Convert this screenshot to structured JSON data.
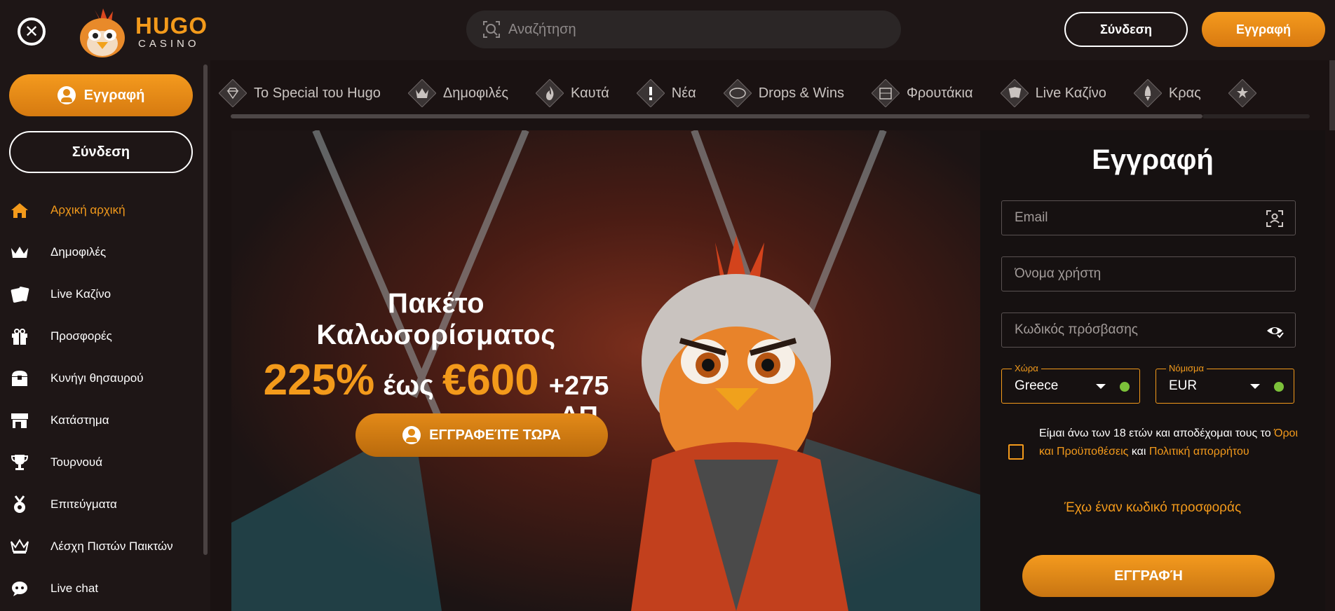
{
  "brand": {
    "name": "HUGO",
    "sub": "CASINO"
  },
  "header": {
    "search_placeholder": "Αναζήτηση",
    "login_label": "Σύνδεση",
    "register_label": "Εγγραφή"
  },
  "sidebar": {
    "register_label": "Εγγραφή",
    "login_label": "Σύνδεση",
    "items": [
      {
        "label": "Αρχική αρχική",
        "icon": "home-icon",
        "active": true
      },
      {
        "label": "Δημοφιλές",
        "icon": "crown-icon"
      },
      {
        "label": "Live Καζίνο",
        "icon": "cards-icon"
      },
      {
        "label": "Προσφορές",
        "icon": "gift-icon"
      },
      {
        "label": "Κυνήγι θησαυρού",
        "icon": "treasure-chest-icon"
      },
      {
        "label": "Κατάστημα",
        "icon": "store-icon"
      },
      {
        "label": "Τουρνουά",
        "icon": "trophy-icon"
      },
      {
        "label": "Επιτεύγματα",
        "icon": "medal-icon"
      },
      {
        "label": "Λέσχη Πιστών Παικτών",
        "icon": "vip-crown-icon"
      },
      {
        "label": "Live chat",
        "icon": "chat-icon"
      }
    ]
  },
  "categories": [
    {
      "label": "Το Special του Hugo",
      "icon": "diamond-icon"
    },
    {
      "label": "Δημοφιλές",
      "icon": "crown-icon"
    },
    {
      "label": "Καυτά",
      "icon": "flame-icon"
    },
    {
      "label": "Νέα",
      "icon": "alert-icon"
    },
    {
      "label": "Drops & Wins",
      "icon": "drops-wins-icon"
    },
    {
      "label": "Φρουτάκια",
      "icon": "slot-icon"
    },
    {
      "label": "Live Καζίνο",
      "icon": "cards-icon"
    },
    {
      "label": "Κρας",
      "icon": "rocket-icon"
    }
  ],
  "banner": {
    "line1": "Πακέτο Καλωσορίσματος",
    "percent": "225%",
    "upto": "έως",
    "amount": "€600",
    "freespins": "+275 ΔΠ",
    "cta": "ΕΓΓΡΑΦΕΊΤΕ ΤΩΡΑ"
  },
  "register": {
    "title": "Εγγραφή",
    "email_placeholder": "Email",
    "username_placeholder": "Όνομα χρήστη",
    "password_placeholder": "Κωδικός πρόσβασης",
    "country_label": "Χώρα",
    "country_value": "Greece",
    "currency_label": "Νόμισμα",
    "currency_value": "EUR",
    "agree_prefix": "Είμαι άνω των 18 ετών και αποδέχομαι τους το",
    "terms_link": "Όροι και Προϋποθέσεις",
    "agree_and": "και",
    "privacy_link": "Πολιτική απορρήτου",
    "promo_link": "Έχω έναν κωδικό προσφοράς",
    "submit_label": "ΕΓΓΡΑΦΉ"
  },
  "colors": {
    "accent": "#f39a1b",
    "background": "#1e1616",
    "success": "#7cc13a"
  }
}
